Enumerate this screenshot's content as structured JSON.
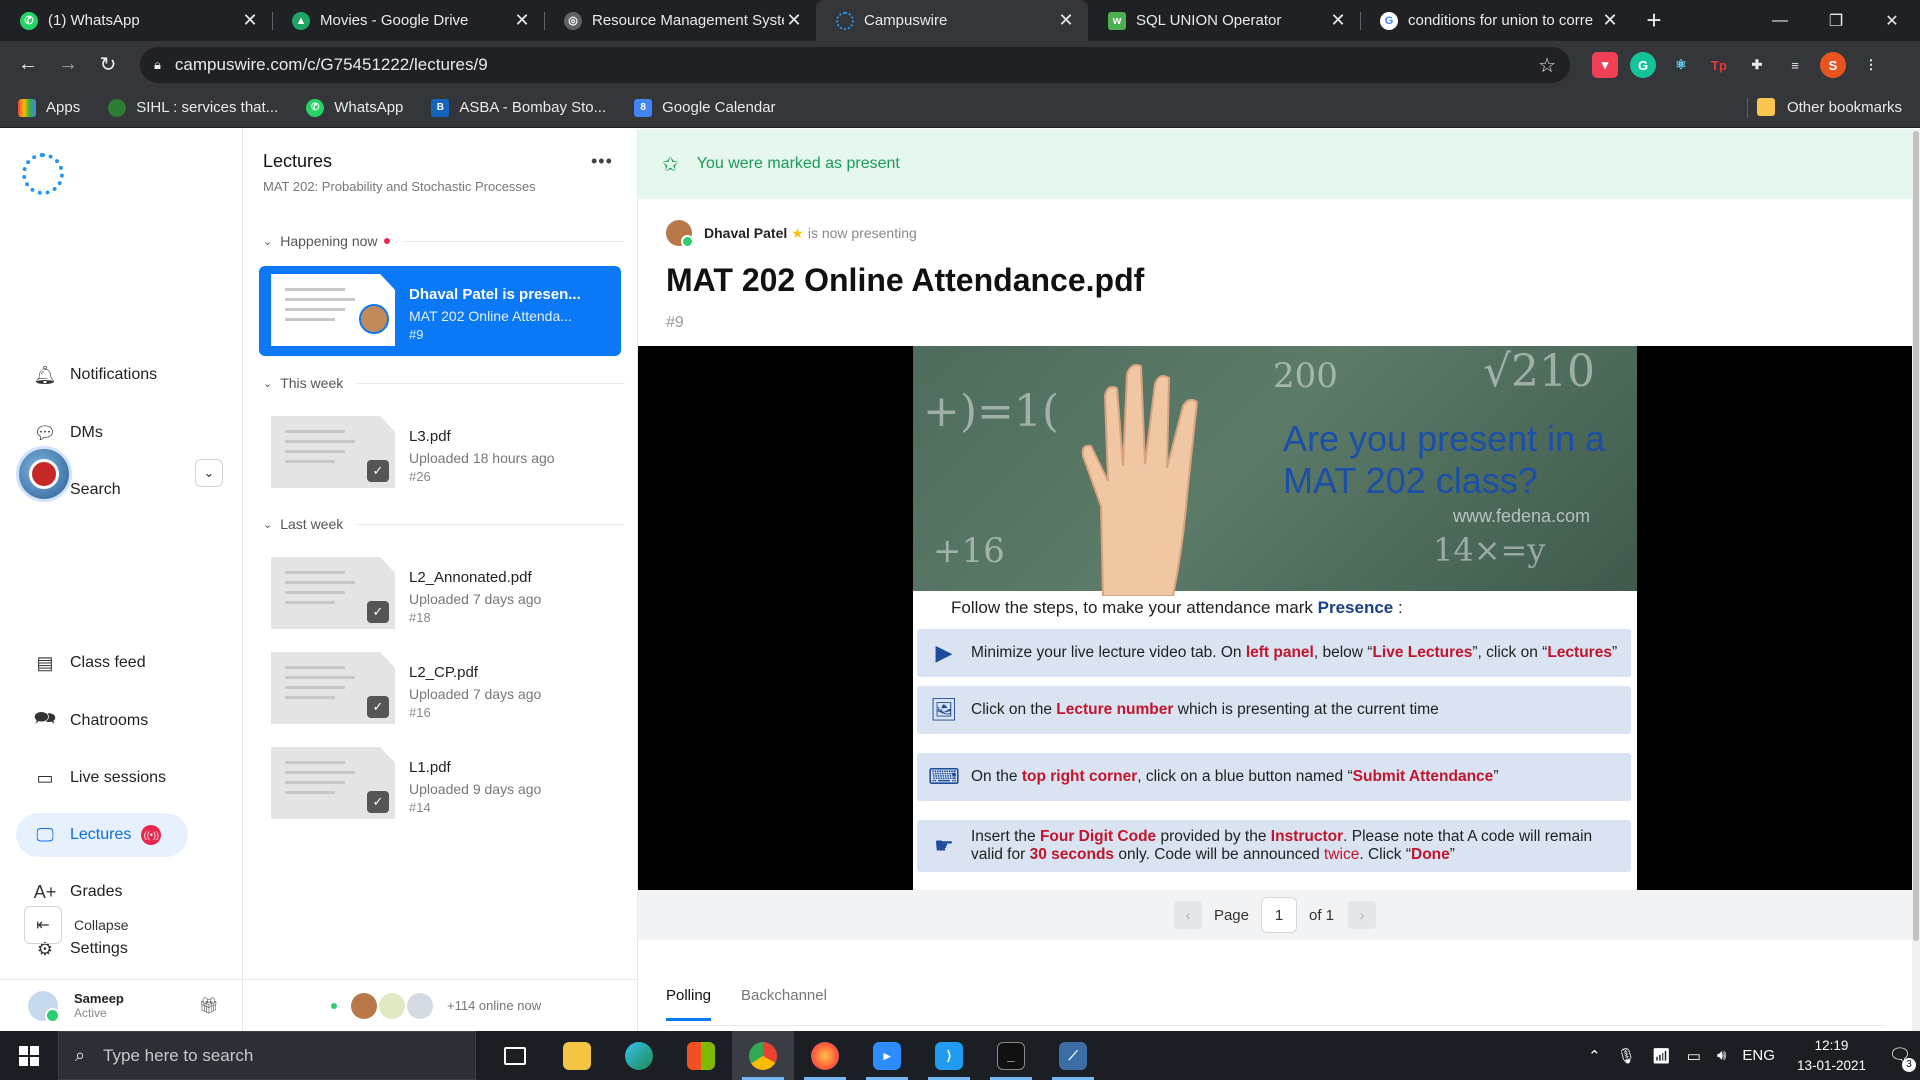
{
  "browser": {
    "tabs": [
      {
        "title": "(1) WhatsApp",
        "icon": "whatsapp-icon",
        "color": "#25d366",
        "active": false
      },
      {
        "title": "Movies - Google Drive",
        "icon": "google-drive-icon",
        "color": "#1fa463",
        "active": false
      },
      {
        "title": "Resource Management Syste",
        "icon": "globe-icon",
        "color": "#5f6368",
        "active": false
      },
      {
        "title": "Campuswire",
        "icon": "campuswire-icon",
        "color": "#2196f3",
        "active": true
      },
      {
        "title": "SQL UNION Operator",
        "icon": "w3schools-icon",
        "color": "#4caf50",
        "active": false
      },
      {
        "title": "conditions for union to corre",
        "icon": "google-icon",
        "color": "#4285f4",
        "active": false
      }
    ],
    "url": "campuswire.com/c/G75451222/lectures/9",
    "bookmarks": [
      "Apps",
      "SIHL : services that...",
      "WhatsApp",
      "ASBA - Bombay Sto...",
      "Google Calendar"
    ],
    "other_bookmarks": "Other bookmarks",
    "profile_initial": "S"
  },
  "sidebar": {
    "items": [
      {
        "label": "Notifications",
        "icon": "bell-icon"
      },
      {
        "label": "DMs",
        "icon": "chat-bubble-icon"
      },
      {
        "label": "Search",
        "icon": "search-icon"
      },
      {
        "label": "Class feed",
        "icon": "document-icon"
      },
      {
        "label": "Chatrooms",
        "icon": "chatrooms-icon"
      },
      {
        "label": "Live sessions",
        "icon": "video-camera-icon"
      },
      {
        "label": "Lectures",
        "icon": "presentation-icon"
      },
      {
        "label": "Grades",
        "icon": "grades-icon"
      },
      {
        "label": "Settings",
        "icon": "gear-icon"
      }
    ],
    "collapse_label": "Collapse",
    "user": {
      "name": "Sameep",
      "status": "Active"
    }
  },
  "lectures": {
    "title": "Lectures",
    "subtitle": "MAT 202: Probability and Stochastic Processes",
    "sections": {
      "now": "Happening now",
      "week": "This week",
      "last": "Last week"
    },
    "current": {
      "title": "Dhaval Patel is presen...",
      "sub": "MAT 202 Online Attenda...",
      "num": "#9"
    },
    "items": [
      {
        "name": "L3.pdf",
        "uploaded": "Uploaded 18 hours ago",
        "num": "#26"
      },
      {
        "name": "L2_Annonated.pdf",
        "uploaded": "Uploaded 7 days ago",
        "num": "#18"
      },
      {
        "name": "L2_CP.pdf",
        "uploaded": "Uploaded 7 days ago",
        "num": "#16"
      },
      {
        "name": "L1.pdf",
        "uploaded": "Uploaded 9 days ago",
        "num": "#14"
      }
    ],
    "online": "+114 online now"
  },
  "main": {
    "toast": "You were marked as present",
    "presenter_name": "Dhaval Patel",
    "presenter_text": "is now presenting",
    "doc_title": "MAT 202 Online Attendance.pdf",
    "doc_num": "#9",
    "slide": {
      "question_line1": "Are you present in a",
      "question_line2": "MAT 202 class?",
      "watermark": "www.fedena.com",
      "instruction": "Follow the steps, to make your attendance mark ",
      "instruction_bold": "Presence",
      "instruction_end": " :"
    },
    "pager": {
      "label": "Page",
      "current": "1",
      "of": "of 1"
    },
    "tabs": [
      "Polling",
      "Backchannel"
    ]
  },
  "taskbar": {
    "search_placeholder": "Type here to search",
    "lang": "ENG",
    "time": "12:19",
    "date": "13-01-2021",
    "notif_count": "3"
  }
}
